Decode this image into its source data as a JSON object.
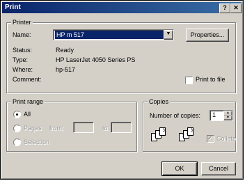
{
  "window": {
    "title": "Print",
    "help_glyph": "?",
    "close_glyph": "✕"
  },
  "printer": {
    "group_label": "Printer",
    "name_label": "Name:",
    "name_value": "HP m 517",
    "properties_label": "Properties...",
    "status_label": "Status:",
    "status_value": "Ready",
    "type_label": "Type:",
    "type_value": "HP LaserJet 4050 Series PS",
    "where_label": "Where:",
    "where_value": "hp-517",
    "comment_label": "Comment:",
    "print_to_file_label": "Print to file",
    "print_to_file_checked": false
  },
  "print_range": {
    "group_label": "Print range",
    "all_label": "All",
    "pages_label": "Pages",
    "from_label": "from:",
    "to_label": "to:",
    "selection_label": "Selection",
    "selected": "All"
  },
  "copies": {
    "group_label": "Copies",
    "number_label": "Number of copies:",
    "number_value": "1",
    "collate_label": "Collate",
    "collate_checked": true,
    "collate_enabled": false,
    "page_numbers": [
      "1",
      "2",
      "3"
    ]
  },
  "buttons": {
    "ok_label": "OK",
    "cancel_label": "Cancel"
  }
}
